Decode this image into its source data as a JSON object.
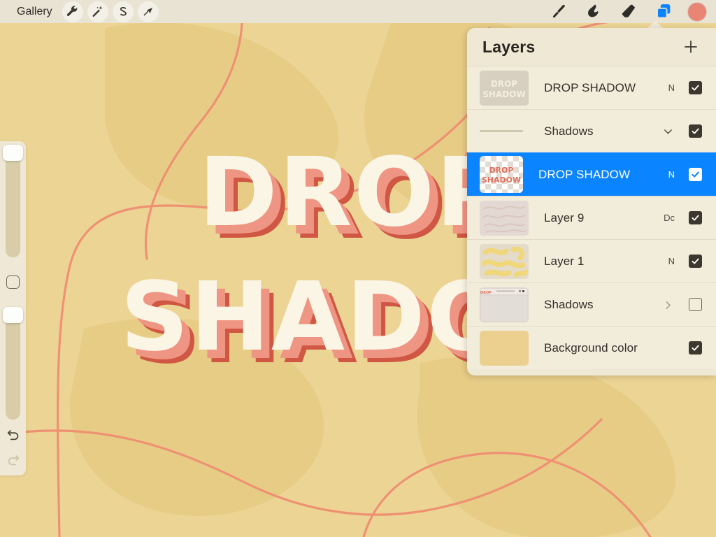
{
  "topbar": {
    "gallery_label": "Gallery",
    "left_tools": [
      {
        "name": "wrench-icon",
        "label": "Actions"
      },
      {
        "name": "wand-icon",
        "label": "Adjustments"
      },
      {
        "name": "selection-icon",
        "label": "Selection"
      },
      {
        "name": "transform-arrow-icon",
        "label": "Transform"
      }
    ],
    "right_tools": [
      {
        "name": "paintbrush-icon",
        "label": "Paint"
      },
      {
        "name": "smudge-icon",
        "label": "Smudge"
      },
      {
        "name": "eraser-icon",
        "label": "Erase"
      },
      {
        "name": "layers-icon",
        "label": "Layers"
      }
    ],
    "color_swatch": "#e98574",
    "active_tool": "layers-icon"
  },
  "sidebar": {
    "brush_size_label": "Brush size",
    "brush_size_value": "100%",
    "opacity_label": "Opacity",
    "opacity_value": "100%",
    "modify_label": "Modify",
    "undo_label": "Undo",
    "redo_label": "Redo"
  },
  "layers_panel": {
    "title": "Layers",
    "add_label": "+",
    "rows": [
      {
        "name": "DROP SHADOW",
        "blend": "N",
        "visible": true,
        "selected": false,
        "type": "layer",
        "thumb": "text-tan"
      },
      {
        "name": "Shadows",
        "blend": "",
        "visible": true,
        "selected": false,
        "type": "group-open",
        "thumb": "rule"
      },
      {
        "name": "DROP SHADOW",
        "blend": "N",
        "visible": true,
        "selected": true,
        "type": "layer",
        "thumb": "text-checker"
      },
      {
        "name": "Layer 9",
        "blend": "Dc",
        "visible": true,
        "selected": false,
        "type": "layer",
        "thumb": "squiggle-pink"
      },
      {
        "name": "Layer 1",
        "blend": "N",
        "visible": true,
        "selected": false,
        "type": "layer",
        "thumb": "squiggle-yellow"
      },
      {
        "name": "Shadows",
        "blend": "",
        "visible": false,
        "selected": false,
        "type": "group-closed",
        "thumb": "mini-ui"
      },
      {
        "name": "Background color",
        "blend": "",
        "visible": true,
        "selected": false,
        "type": "background",
        "thumb": "bg-swatch"
      }
    ]
  },
  "canvas": {
    "artwork_line1": "DROP",
    "artwork_line2": "SHADOW",
    "background_color": "#ecd494",
    "text_color": "#fbf5e6",
    "shadow_color_light": "#ef9583",
    "shadow_color_dark": "#cf5743",
    "line_color": "#ef8e72"
  }
}
